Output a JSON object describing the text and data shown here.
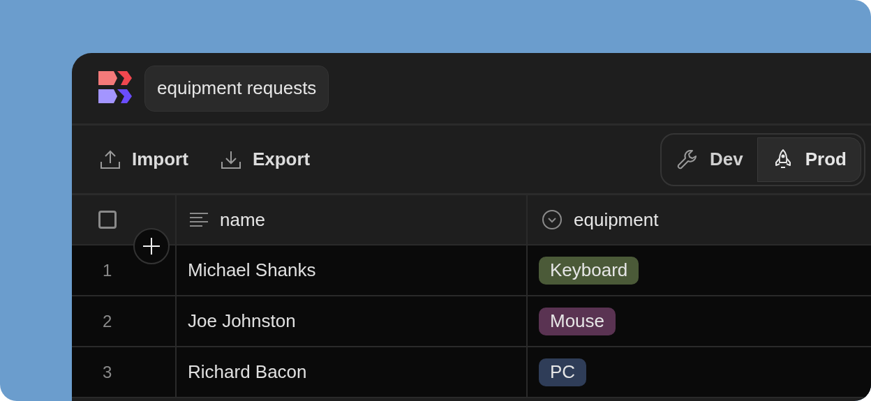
{
  "app": {
    "title": "equipment requests"
  },
  "toolbar": [
    {
      "kind": "import",
      "label": "Import"
    },
    {
      "kind": "export",
      "label": "Export"
    }
  ],
  "environments": [
    {
      "kind": "dev",
      "label": "Dev",
      "selected": false
    },
    {
      "kind": "prod",
      "label": "Prod",
      "selected": true
    }
  ],
  "table": {
    "select_all": {
      "checked": false
    },
    "columns": [
      {
        "kind": "text",
        "label": "name"
      },
      {
        "kind": "select",
        "label": "equipment"
      }
    ],
    "rows": [
      {
        "number": "1",
        "name": "Michael Shanks",
        "equipment": {
          "label": "Keyboard",
          "color": "#4b5a38"
        }
      },
      {
        "number": "2",
        "name": "Joe Johnston",
        "equipment": {
          "label": "Mouse",
          "color": "#5a3352"
        }
      },
      {
        "number": "3",
        "name": "Richard Bacon",
        "equipment": {
          "label": "PC",
          "color": "#2f3d58"
        }
      }
    ]
  }
}
